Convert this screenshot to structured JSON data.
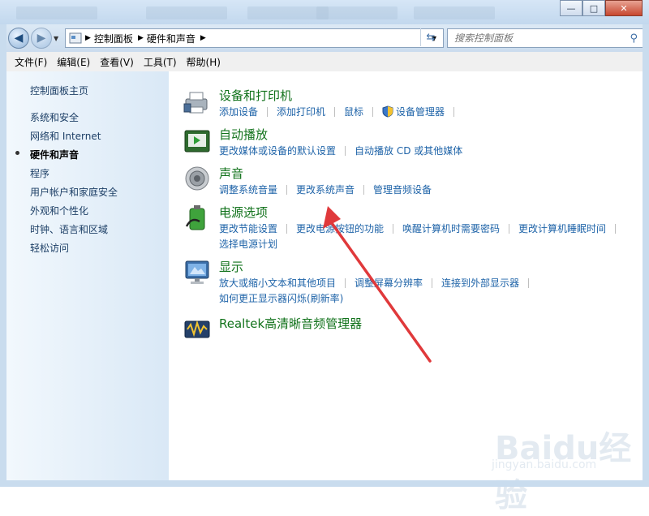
{
  "window": {
    "minimize": "—",
    "maximize": "□",
    "close": "✕"
  },
  "nav": {
    "breadcrumb": [
      "控制面板",
      "硬件和声音"
    ],
    "search_placeholder": "搜索控制面板"
  },
  "menu": [
    "文件(F)",
    "编辑(E)",
    "查看(V)",
    "工具(T)",
    "帮助(H)"
  ],
  "sidebar": {
    "home": "控制面板主页",
    "items": [
      "系统和安全",
      "网络和 Internet",
      "硬件和声音",
      "程序",
      "用户帐户和家庭安全",
      "外观和个性化",
      "时钟、语言和区域",
      "轻松访问"
    ],
    "current_index": 2
  },
  "categories": [
    {
      "title": "设备和打印机",
      "icon": "printer-icon",
      "links": [
        [
          "添加设备",
          "添加打印机",
          "鼠标",
          "设备管理器"
        ]
      ]
    },
    {
      "title": "自动播放",
      "icon": "autoplay-icon",
      "links": [
        [
          "更改媒体或设备的默认设置",
          "自动播放 CD 或其他媒体"
        ]
      ]
    },
    {
      "title": "声音",
      "icon": "speaker-icon",
      "links": [
        [
          "调整系统音量",
          "更改系统声音",
          "管理音频设备"
        ]
      ]
    },
    {
      "title": "电源选项",
      "icon": "battery-icon",
      "links": [
        [
          "更改节能设置",
          "更改电源按钮的功能",
          "唤醒计算机时需要密码",
          "更改计算机睡眠时间"
        ],
        [
          "选择电源计划"
        ]
      ]
    },
    {
      "title": "显示",
      "icon": "monitor-icon",
      "links": [
        [
          "放大或缩小文本和其他项目",
          "调整屏幕分辨率",
          "连接到外部显示器"
        ],
        [
          "如何更正显示器闪烁(刷新率)"
        ]
      ]
    },
    {
      "title": "Realtek高清晰音频管理器",
      "icon": "realtek-audio-icon",
      "links": []
    }
  ],
  "watermark": {
    "logo": "Baidu经验",
    "url": "jingyan.baidu.com"
  },
  "annotation_color": "#e0393b"
}
